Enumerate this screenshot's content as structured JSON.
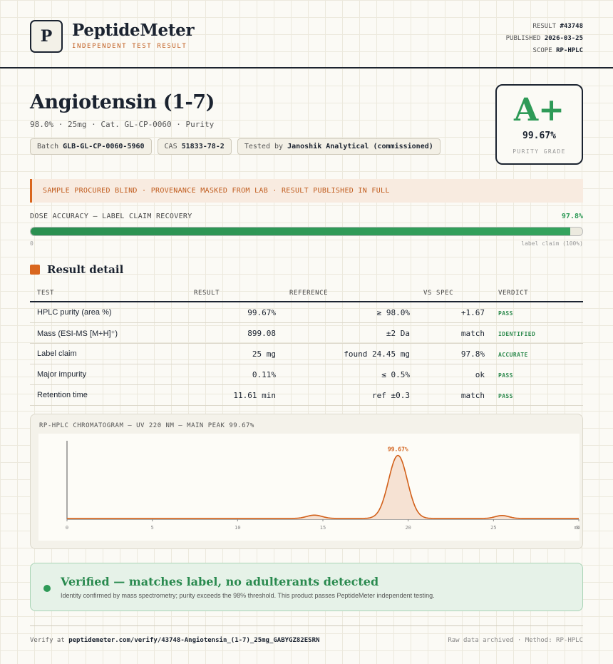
{
  "brand": {
    "logo_letter": "P",
    "name": "PeptideMeter",
    "subtitle": "INDEPENDENT TEST RESULT"
  },
  "meta": {
    "result_label": "RESULT",
    "result_value": "#43748",
    "published_label": "PUBLISHED",
    "published_value": "2026-03-25",
    "scope_label": "SCOPE",
    "scope_value": "RP-HPLC"
  },
  "product": {
    "title": "Angiotensin (1-7)",
    "subtitle": "98.0% · 25mg · Cat. GL-CP-0060 · Purity",
    "chips": [
      {
        "label": "Batch",
        "value": "GLB-GL-CP-0060-5960"
      },
      {
        "label": "CAS",
        "value": "51833-78-2"
      },
      {
        "label": "Tested by",
        "value": "Janoshik Analytical (commissioned)"
      }
    ]
  },
  "grade": {
    "letter": "A+",
    "value": "99.67%",
    "label": "PURITY GRADE"
  },
  "notice": "SAMPLE PROCURED BLIND · PROVENANCE MASKED FROM LAB · RESULT PUBLISHED IN FULL",
  "dose": {
    "label": "DOSE ACCURACY — LABEL CLAIM RECOVERY",
    "value_text": "97.8%",
    "fraction": 0.978,
    "min_label": "0",
    "max_label": "label claim (100%)"
  },
  "result_section": {
    "title": "Result detail",
    "headers": [
      "TEST",
      "RESULT",
      "REFERENCE",
      "VS SPEC",
      "VERDICT"
    ],
    "rows": [
      {
        "test": "HPLC purity (area %)",
        "result": "99.67%",
        "reference": "≥ 98.0%",
        "vs": "+1.67",
        "verdict": "PASS"
      },
      {
        "test": "Mass (ESI-MS [M+H]⁺)",
        "result": "899.08",
        "reference": "±2 Da",
        "vs": "match",
        "verdict": "IDENTIFIED"
      },
      {
        "test": "Label claim",
        "result": "25 mg",
        "reference": "found 24.45 mg",
        "vs": "97.8%",
        "verdict": "ACCURATE"
      },
      {
        "test": "Major impurity",
        "result": "0.11%",
        "reference": "≤ 0.5%",
        "vs": "ok",
        "verdict": "PASS"
      },
      {
        "test": "Retention time",
        "result": "11.61 min",
        "reference": "ref ±0.3",
        "vs": "match",
        "verdict": "PASS"
      }
    ]
  },
  "chart_data": {
    "type": "line",
    "title": "RP-HPLC CHROMATOGRAM — UV 220 NM — MAIN PEAK 99.67%",
    "xlim": [
      0,
      30
    ],
    "x_ticks": [
      0,
      5,
      10,
      15,
      20,
      25,
      30
    ],
    "x_tick_labels": [
      "0",
      "5",
      "10",
      "15",
      "20",
      "25",
      "30"
    ],
    "x_unit_label": "min",
    "ylim": [
      0,
      100
    ],
    "peak_label": "99.67%",
    "baseline": 1.0,
    "peaks": [
      {
        "x": 14.5,
        "height": 4.5,
        "width": 0.45
      },
      {
        "x": 19.4,
        "height": 85,
        "width": 0.55
      },
      {
        "x": 25.5,
        "height": 4,
        "width": 0.4
      }
    ],
    "line_color": "#d2601a",
    "fill_color": "#f6e2d3"
  },
  "verified": {
    "title": "Verified — matches label, no adulterants detected",
    "text": "Identity confirmed by mass spectrometry; purity exceeds the 98% threshold. This product passes PeptideMeter independent testing."
  },
  "footer": {
    "verify_label": "Verify at",
    "verify_url": "peptidemeter.com/verify/43748-Angiotensin_(1-7)_25mg_GABYGZ82ESRN",
    "right_text": "Raw data archived · Method: RP-HPLC"
  }
}
